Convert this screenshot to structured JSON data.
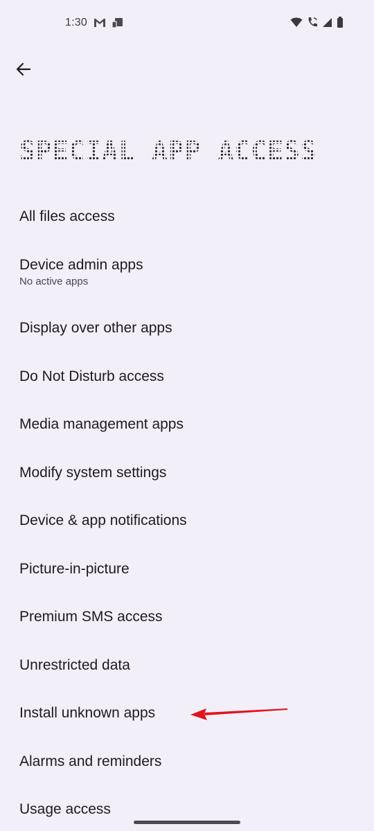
{
  "status_bar": {
    "time": "1:30",
    "left_icons": [
      "gmail-icon",
      "cast-device-icon"
    ],
    "right_icons": [
      "wifi-icon",
      "wifi-calling-icon",
      "cellular-signal-icon",
      "battery-icon"
    ]
  },
  "header": {
    "back_icon": "arrow-back-icon",
    "title": "SPECIAL APP ACCESS"
  },
  "items": [
    {
      "title": "All files access"
    },
    {
      "title": "Device admin apps",
      "summary": "No active apps"
    },
    {
      "title": "Display over other apps"
    },
    {
      "title": "Do Not Disturb access"
    },
    {
      "title": "Media management apps"
    },
    {
      "title": "Modify system settings"
    },
    {
      "title": "Device & app notifications"
    },
    {
      "title": "Picture-in-picture"
    },
    {
      "title": "Premium SMS access"
    },
    {
      "title": "Unrestricted data"
    },
    {
      "title": "Install unknown apps"
    },
    {
      "title": "Alarms and reminders"
    },
    {
      "title": "Usage access"
    }
  ],
  "annotation": {
    "type": "arrow",
    "color": "#e0141c",
    "points_to": "Install unknown apps"
  },
  "colors": {
    "background": "#f3eff8",
    "text_primary": "#1c1b1f",
    "text_secondary": "#46464f"
  }
}
